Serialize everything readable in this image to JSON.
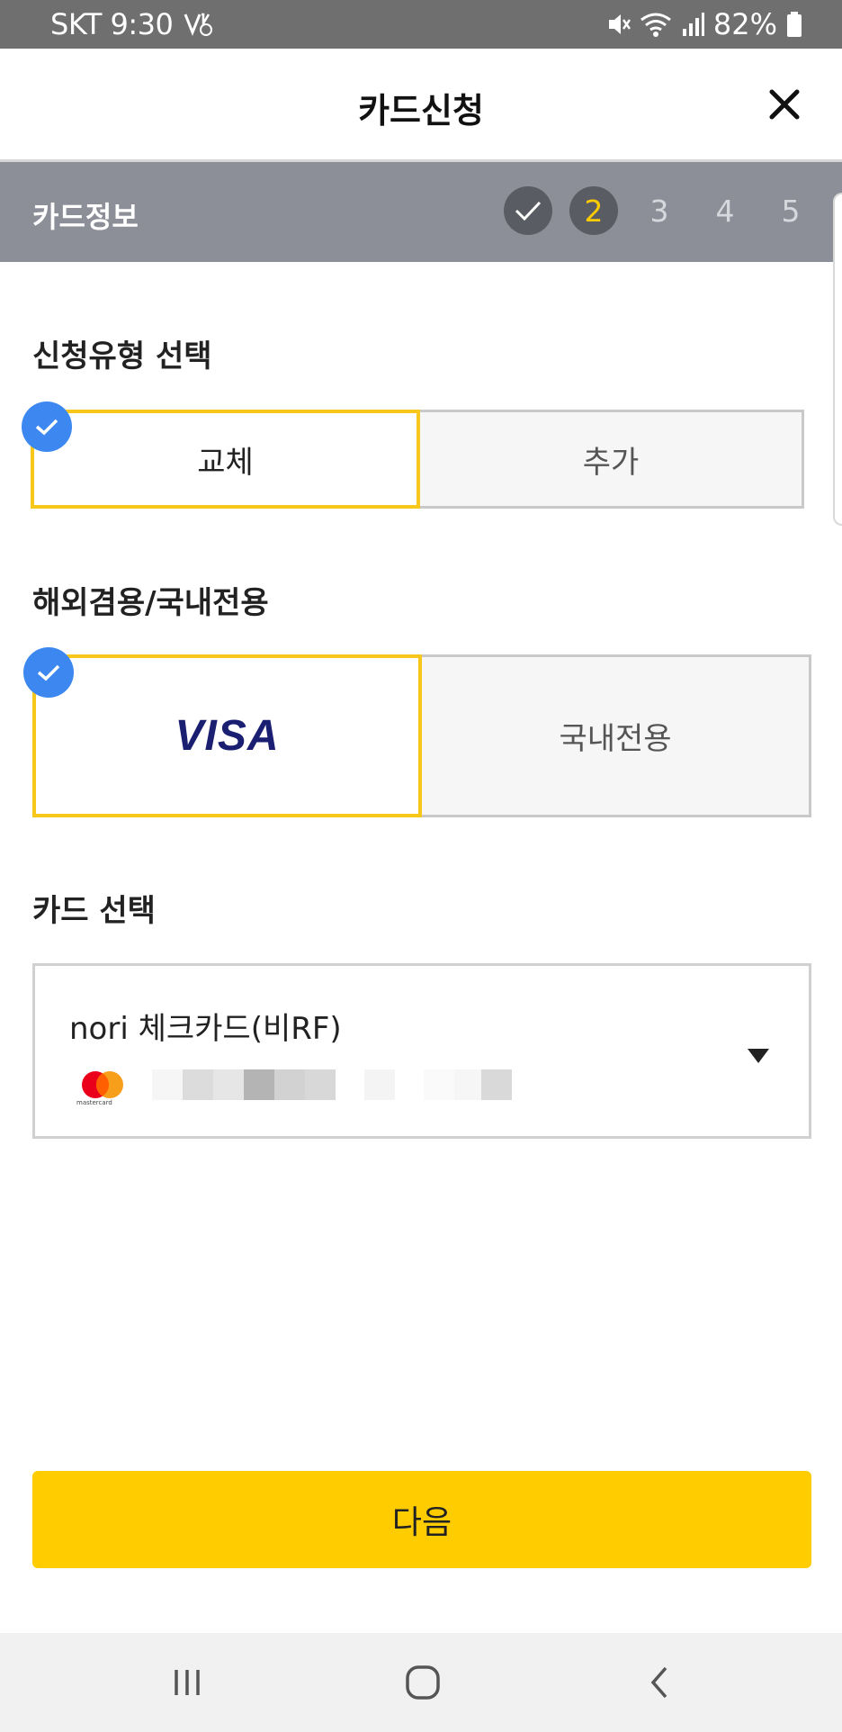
{
  "status_bar": {
    "carrier_time": "SKT 9:30",
    "battery": "82%",
    "icons": [
      "volte-icon",
      "mute-icon",
      "wifi-icon",
      "signal-icon",
      "battery-icon"
    ]
  },
  "header": {
    "title": "카드신청",
    "close_icon": "close-icon"
  },
  "step_bar": {
    "title": "카드정보",
    "steps": [
      {
        "label": "",
        "state": "done"
      },
      {
        "label": "2",
        "state": "current"
      },
      {
        "label": "3",
        "state": "upcoming"
      },
      {
        "label": "4",
        "state": "upcoming"
      },
      {
        "label": "5",
        "state": "upcoming"
      }
    ]
  },
  "application_type": {
    "label": "신청유형 선택",
    "options": [
      "교체",
      "추가"
    ],
    "selected": "교체"
  },
  "usage_type": {
    "label": "해외겸용/국내전용",
    "options": [
      "VISA",
      "국내전용"
    ],
    "selected": "VISA"
  },
  "card_select": {
    "label": "카드 선택",
    "card_name": "nori 체크카드(비RF)",
    "brand_icon": "mastercard-logo-icon",
    "brand_text": "mastercard"
  },
  "next_button": {
    "label": "다음"
  },
  "nav_bar": {
    "icons": [
      "recent-apps-icon",
      "home-icon",
      "back-icon"
    ]
  },
  "colors": {
    "accent": "#ffcc00",
    "step_bar": "#8d8f98",
    "check_badge": "#3c87f0",
    "visa_blue": "#1a1f71"
  }
}
